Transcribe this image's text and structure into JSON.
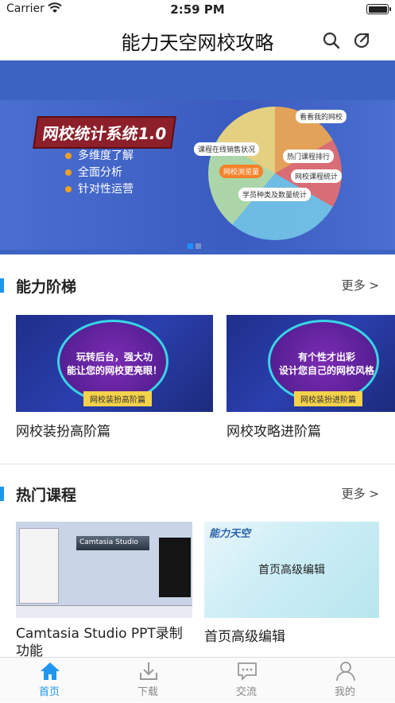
{
  "status_bar": {
    "carrier": "Carrier",
    "time": "2:59 PM"
  },
  "navbar": {
    "title": "能力天空网校攻略",
    "icons": [
      "search-icon",
      "share-icon"
    ]
  },
  "banner": {
    "heading": "网校统计系统1.0",
    "bullets": [
      "多维度了解",
      "全面分析",
      "针对性运营"
    ],
    "tags": [
      "看看我的网校",
      "课程在线销售状况",
      "热门课程排行",
      "网校浏览量",
      "网校课程统计",
      "学员种类及数量统计"
    ],
    "page_count": 2,
    "active_page": 0
  },
  "section1": {
    "title": "能力阶梯",
    "more": "更多 >",
    "cards": [
      {
        "title": "网校装扮高阶篇",
        "thumb_lines": [
          "玩转后台，强大功",
          "能让您的网校更亮眼！"
        ],
        "thumb_ribbon": "网校装扮高阶篇"
      },
      {
        "title": "网校攻略进阶篇",
        "thumb_lines": [
          "有个性才出彩",
          "设计您自己的网校风格"
        ],
        "thumb_ribbon": "网校装扮进阶篇"
      }
    ]
  },
  "section2": {
    "title": "热门课程",
    "more": "更多 >",
    "cards": [
      {
        "title": "Camtasia Studio PPT录制功能",
        "thumb_text": "Camtasia Studio"
      },
      {
        "title": "首页高级编辑",
        "thumb_brand": "能力天空",
        "thumb_caption": "首页高级编辑"
      }
    ]
  },
  "tabbar": [
    {
      "label": "首页",
      "icon": "home-icon",
      "active": true
    },
    {
      "label": "下载",
      "icon": "download-icon",
      "active": false
    },
    {
      "label": "交流",
      "icon": "chat-icon",
      "active": false
    },
    {
      "label": "我的",
      "icon": "user-icon",
      "active": false
    }
  ],
  "colors": {
    "accent": "#1e96f0",
    "banner_bg": "#3d63c2",
    "inactive_tab": "#888888"
  }
}
